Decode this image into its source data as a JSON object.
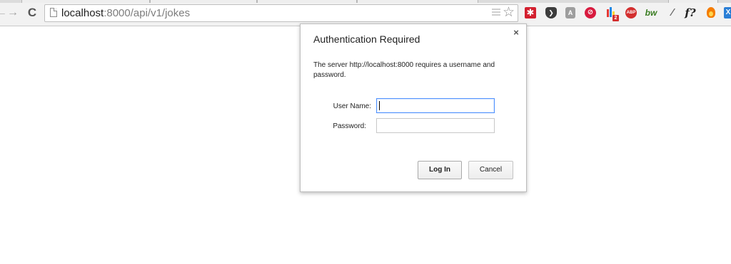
{
  "browser": {
    "url_host": "localhost",
    "url_rest": ":8000/api/v1/jokes",
    "nav": {
      "back": "←",
      "forward": "→",
      "reload": "C"
    },
    "extensions": [
      {
        "name": "lastpass-icon",
        "glyph": "✱"
      },
      {
        "name": "pocket-icon",
        "glyph": "❯"
      },
      {
        "name": "angularjs-batarang-icon",
        "glyph": "A"
      },
      {
        "name": "tracking-icon",
        "glyph": "⊘"
      },
      {
        "name": "bar-chart-badge-icon",
        "badge": "2"
      },
      {
        "name": "adblock-plus-icon",
        "glyph": "ABP"
      },
      {
        "name": "builtwith-icon",
        "glyph": "bw"
      },
      {
        "name": "eyedropper-icon",
        "glyph": "⁄"
      },
      {
        "name": "formula-icon",
        "glyph": "f?"
      },
      {
        "name": "fire-icon"
      },
      {
        "name": "partial-extension-icon",
        "glyph": "X"
      }
    ]
  },
  "dialog": {
    "title": "Authentication Required",
    "close": "×",
    "message": "The server http://localhost:8000 requires a username and password.",
    "username_label": "User Name:",
    "password_label": "Password:",
    "username_value": "",
    "password_value": "",
    "login_label": "Log In",
    "cancel_label": "Cancel"
  },
  "colors": {
    "focus_border": "#4d90fe",
    "chrome_bg": "#f2f2f2",
    "lastpass_red": "#d3202f",
    "abp_red": "#d32f2f"
  }
}
